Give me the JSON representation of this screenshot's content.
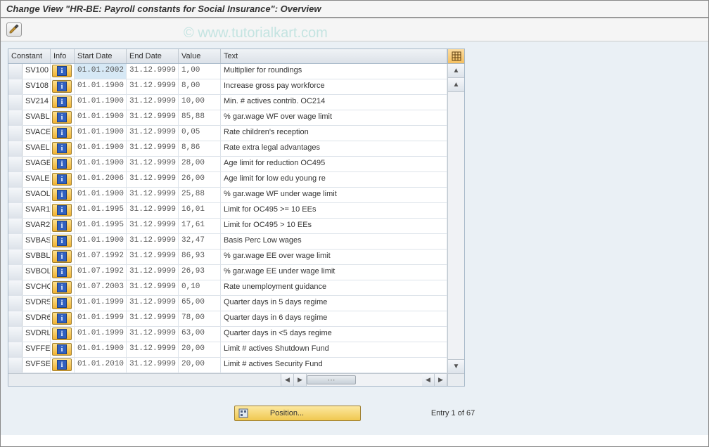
{
  "title": "Change View \"HR-BE: Payroll constants for Social Insurance\": Overview",
  "watermark": "© www.tutorialkart.com",
  "columns": {
    "constant": "Constant",
    "info": "Info",
    "start": "Start Date",
    "end": "End Date",
    "value": "Value",
    "text": "Text"
  },
  "rows": [
    {
      "constant": "SV100",
      "start": "01.01.2002",
      "end": "31.12.9999",
      "value": "1,00",
      "text": "Multiplier for roundings",
      "hl": true
    },
    {
      "constant": "SV108",
      "start": "01.01.1900",
      "end": "31.12.9999",
      "value": "8,00",
      "text": "Increase gross pay workforce"
    },
    {
      "constant": "SV214",
      "start": "01.01.1900",
      "end": "31.12.9999",
      "value": "10,00",
      "text": "Min. # actives contrib. OC214"
    },
    {
      "constant": "SVABL",
      "start": "01.01.1900",
      "end": "31.12.9999",
      "value": "85,88",
      "text": "% gar.wage WF over wage limit"
    },
    {
      "constant": "SVACE",
      "start": "01.01.1900",
      "end": "31.12.9999",
      "value": "0,05",
      "text": "Rate children's reception"
    },
    {
      "constant": "SVAEL",
      "start": "01.01.1900",
      "end": "31.12.9999",
      "value": "8,86",
      "text": "Rate extra legal advantages"
    },
    {
      "constant": "SVAGE",
      "start": "01.01.1900",
      "end": "31.12.9999",
      "value": "28,00",
      "text": "Age limit for reduction OC495"
    },
    {
      "constant": "SVALE",
      "start": "01.01.2006",
      "end": "31.12.9999",
      "value": "26,00",
      "text": "Age limit for low edu young re"
    },
    {
      "constant": "SVAOL",
      "start": "01.01.1900",
      "end": "31.12.9999",
      "value": "25,88",
      "text": "% gar.wage WF under wage limit"
    },
    {
      "constant": "SVAR1",
      "start": "01.01.1995",
      "end": "31.12.9999",
      "value": "16,01",
      "text": "Limit for  OC495 >= 10 EEs"
    },
    {
      "constant": "SVAR2",
      "start": "01.01.1995",
      "end": "31.12.9999",
      "value": "17,61",
      "text": "Limit for OC495 > 10 EEs"
    },
    {
      "constant": "SVBAS",
      "start": "01.01.1900",
      "end": "31.12.9999",
      "value": "32,47",
      "text": "Basis Perc Low wages"
    },
    {
      "constant": "SVBBL",
      "start": "01.07.1992",
      "end": "31.12.9999",
      "value": "86,93",
      "text": "% gar.wage EE over wage limit"
    },
    {
      "constant": "SVBOL",
      "start": "01.07.1992",
      "end": "31.12.9999",
      "value": "26,93",
      "text": "% gar.wage EE under wage limit"
    },
    {
      "constant": "SVCHO",
      "start": "01.07.2003",
      "end": "31.12.9999",
      "value": "0,10",
      "text": "Rate unemployment guidance"
    },
    {
      "constant": "SVDR5",
      "start": "01.01.1999",
      "end": "31.12.9999",
      "value": "65,00",
      "text": "Quarter days in 5 days regime"
    },
    {
      "constant": "SVDR6",
      "start": "01.01.1999",
      "end": "31.12.9999",
      "value": "78,00",
      "text": "Quarter days in 6 days regime"
    },
    {
      "constant": "SVDRL",
      "start": "01.01.1999",
      "end": "31.12.9999",
      "value": "63,00",
      "text": "Quarter days in <5 days regime"
    },
    {
      "constant": "SVFFE",
      "start": "01.01.1900",
      "end": "31.12.9999",
      "value": "20,00",
      "text": "Limit # actives Shutdown Fund"
    },
    {
      "constant": "SVFSE",
      "start": "01.01.2010",
      "end": "31.12.9999",
      "value": "20,00",
      "text": "Limit # actives Security Fund"
    }
  ],
  "footer": {
    "position_label": "Position...",
    "entry_text": "Entry 1 of 67"
  }
}
